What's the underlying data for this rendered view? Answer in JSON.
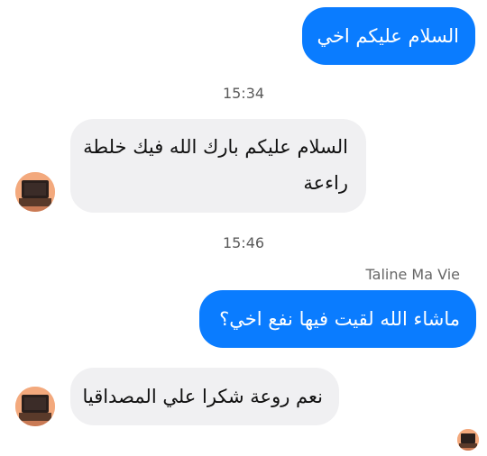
{
  "messages": [
    {
      "text": "السلام عليكم اخي"
    },
    {
      "text": "السلام عليكم بارك الله فيك خلطة",
      "text2": "راءعة"
    },
    {
      "text": "ماشاء الله لقيت فيها نفع اخي؟"
    },
    {
      "text": "نعم روعة شكرا علي المصداقيا"
    }
  ],
  "timestamps": [
    "15:34",
    "15:46"
  ],
  "sender_name": "Taline Ma Vie",
  "colors": {
    "outgoing_bubble": "#0a7cff",
    "incoming_bubble": "#f0f0f2",
    "avatar_bg": "#f3a97d"
  },
  "icons": {
    "avatar": "contact-avatar-icon",
    "read_receipt": "read-receipt-avatar-icon"
  }
}
